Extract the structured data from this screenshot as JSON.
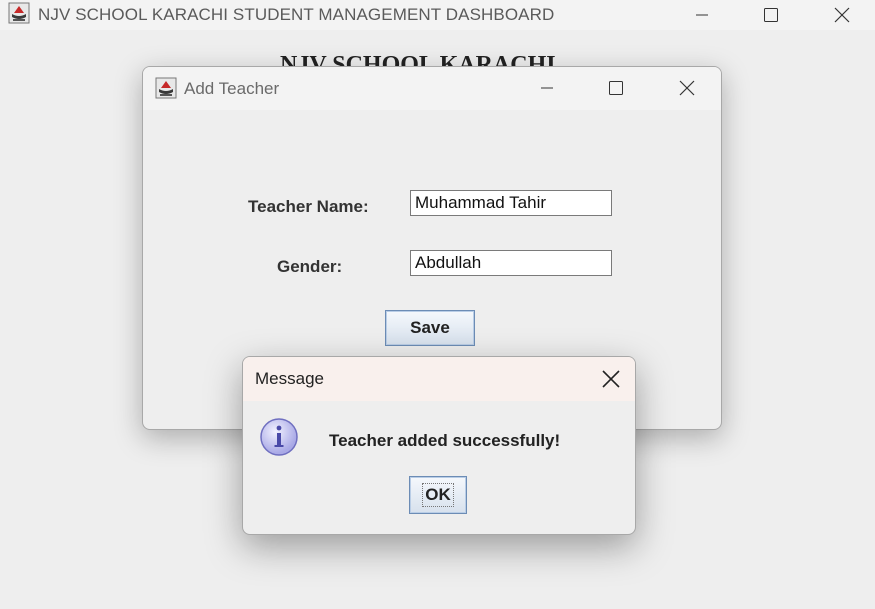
{
  "main_window": {
    "title": "NJV SCHOOL KARACHI STUDENT MANAGEMENT DASHBOARD",
    "heading": "NJV SCHOOL KARACHI",
    "app_icon": "java-cup-icon",
    "controls": [
      "minimize-icon",
      "maximize-icon",
      "close-icon"
    ]
  },
  "add_teacher_dialog": {
    "title": "Add Teacher",
    "fields": [
      {
        "label": "Teacher Name:",
        "value": "Muhammad Tahir"
      },
      {
        "label": "Gender:",
        "value": "Abdullah"
      }
    ],
    "save_label": "Save"
  },
  "message_dialog": {
    "title": "Message",
    "icon": "info-icon",
    "text": "Teacher added successfully!",
    "ok_label": "OK"
  }
}
